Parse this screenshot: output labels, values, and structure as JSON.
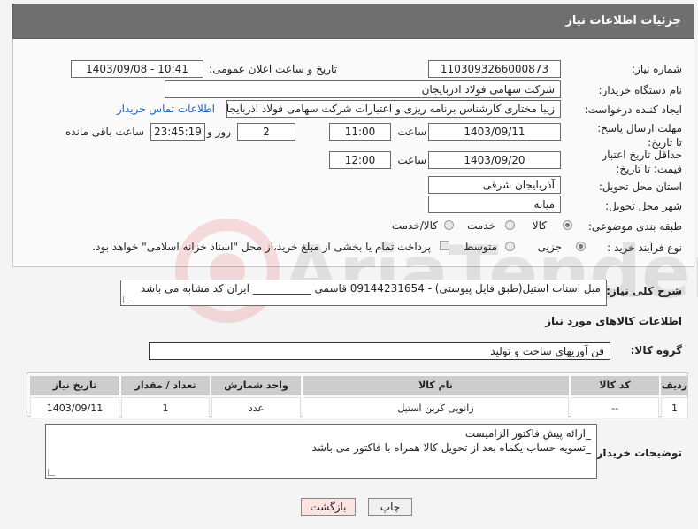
{
  "header": {
    "title": "جزئیات اطلاعات نیاز"
  },
  "need_number": {
    "label": "شماره نیاز:",
    "value": "1103093266000873"
  },
  "announce": {
    "label": "تاریخ و ساعت اعلان عمومی:",
    "value": "1403/09/08 - 10:41"
  },
  "buyer_org": {
    "label": "نام دستگاه خریدار:",
    "value": "شرکت سهامی فولاد اذربایجان"
  },
  "requester": {
    "label": "ایجاد کننده درخواست:",
    "value": "زیبا مختاری کارشناس برنامه ریزی و اعتبارات شرکت سهامی فولاد اذربایجان",
    "contact_link": "اطلاعات تماس خریدار"
  },
  "send_deadline": {
    "label": "مهلت ارسال پاسخ: تا تاریخ:",
    "date": "1403/09/11",
    "time_label": "ساعت",
    "time": "11:00",
    "days": "2",
    "days_label": "روز و",
    "remaining": "23:45:19",
    "remaining_label": "ساعت باقی مانده"
  },
  "price_validity": {
    "label": "حداقل تاریخ اعتبار قیمت: تا تاریخ:",
    "date": "1403/09/20",
    "time_label": "ساعت",
    "time": "12:00"
  },
  "province": {
    "label": "استان محل تحویل:",
    "value": "آذربایجان شرقی"
  },
  "city": {
    "label": "شهر محل تحویل:",
    "value": "میانه"
  },
  "category": {
    "label": "طبقه بندی موضوعی:",
    "options": [
      "کالا",
      "خدمت",
      "کالا/خدمت"
    ],
    "selected": "کالا"
  },
  "process": {
    "label": "نوع فرآیند خرید :",
    "options": [
      "جزیی",
      "متوسط"
    ],
    "selected": "جزیی",
    "payment_note": "پرداخت تمام یا بخشی از مبلغ خرید،از محل \"اسناد خزانه اسلامی\" خواهد بود."
  },
  "description": {
    "label": "شرح کلی نیاز:",
    "value": "مبل اسنات استیل(طبق فایل پیوستی) - 09144231654 قاسمی ___________ ایران کد مشابه می باشد"
  },
  "goods_info": {
    "title": "اطلاعات کالاهای مورد نیاز"
  },
  "goods_group": {
    "label": "گروه کالا:",
    "value": "فن آوریهای ساخت و تولید"
  },
  "table": {
    "headers": {
      "row": "ردیف",
      "code": "کد کالا",
      "name": "نام کالا",
      "unit": "واحد شمارش",
      "qty": "تعداد / مقدار",
      "date": "تاریخ نیاز"
    },
    "rows": [
      {
        "row": "1",
        "code": "--",
        "name": "زانویی کربن استیل",
        "unit": "عدد",
        "qty": "1",
        "date": "1403/09/11"
      }
    ]
  },
  "buyer_notes": {
    "label": "توضیحات خریدار:",
    "line1": "_ارائه پیش فاکتور الزامیست",
    "line2": "_تسویه حساب یکماه بعد از تحویل کالا همراه با فاکتور می باشد"
  },
  "buttons": {
    "print": "چاپ",
    "back": "بازگشت"
  },
  "watermark": {
    "text": "AriaTender.neT"
  }
}
